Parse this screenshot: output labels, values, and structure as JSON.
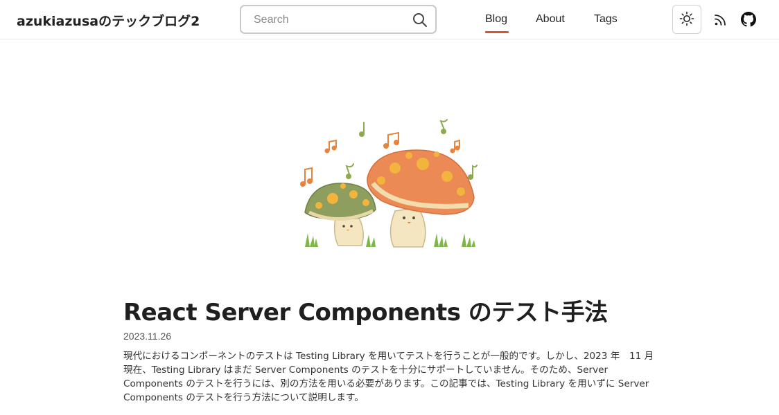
{
  "header": {
    "site_title": "azukiazusaのテックブログ2",
    "search_placeholder": "Search",
    "nav": [
      {
        "label": "Blog",
        "active": true
      },
      {
        "label": "About",
        "active": false
      },
      {
        "label": "Tags",
        "active": false
      }
    ],
    "icons": {
      "search": "search-icon",
      "theme": "sun-icon",
      "rss": "rss-icon",
      "github": "github-icon"
    },
    "accent_color": "#d9532f"
  },
  "post": {
    "title": "React Server Components のテスト手法",
    "date": "2023.11.26",
    "excerpt": "現代におけるコンポーネントのテストは Testing Library を用いてテストを行うことが一般的です。しかし、2023 年　11 月現在、Testing Library はまだ Server Components のテストを十分にサポートしていません。そのため、Server Components のテストを行うには、別の方法を用いる必要があります。この記事では、Testing Library を用いずに Server Components のテストを行う方法について説明します。"
  }
}
